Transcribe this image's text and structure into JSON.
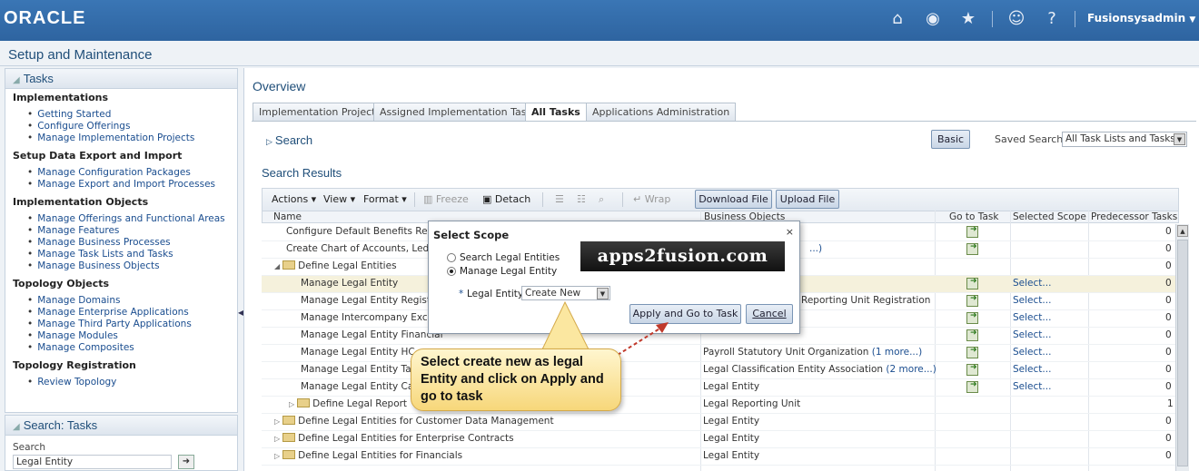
{
  "topbar": {
    "logo": "ORACLE",
    "icons": [
      "home-icon",
      "compass-icon",
      "star-icon",
      "accessibility-icon",
      "help-icon"
    ],
    "user": "Fusionsysadmin"
  },
  "page_title": "Setup and Maintenance",
  "tasks_panel": {
    "title": "Tasks",
    "sections": [
      {
        "title": "Implementations",
        "links": [
          "Getting Started",
          "Configure Offerings",
          "Manage Implementation Projects"
        ]
      },
      {
        "title": "Setup Data Export and Import",
        "links": [
          "Manage Configuration Packages",
          "Manage Export and Import Processes"
        ]
      },
      {
        "title": "Implementation Objects",
        "links": [
          "Manage Offerings and Functional Areas",
          "Manage Features",
          "Manage Business Processes",
          "Manage Task Lists and Tasks",
          "Manage Business Objects"
        ]
      },
      {
        "title": "Topology Objects",
        "links": [
          "Manage Domains",
          "Manage Enterprise Applications",
          "Manage Third Party Applications",
          "Manage Modules",
          "Manage Composites"
        ]
      },
      {
        "title": "Topology Registration",
        "links": [
          "Review Topology"
        ]
      }
    ]
  },
  "search_panel": {
    "title": "Search: Tasks",
    "label": "Search",
    "value": "Legal Entity"
  },
  "overview": {
    "title": "Overview",
    "tabs": [
      "Implementation Projects",
      "Assigned Implementation Tasks",
      "All Tasks",
      "Applications Administration"
    ],
    "active_tab": "All Tasks",
    "search_label": "Search",
    "basic_button": "Basic",
    "saved_search_label": "Saved Search",
    "saved_search_value": "All Task Lists and Tasks",
    "results_title": "Search Results",
    "toolbar": {
      "actions": "Actions",
      "view": "View",
      "format": "Format",
      "freeze": "Freeze",
      "detach": "Detach",
      "wrap": "Wrap",
      "download": "Download File",
      "upload": "Upload File"
    },
    "columns": [
      "Name",
      "Business Objects",
      "Go to Task",
      "Selected Scope",
      "Predecessor Tasks"
    ],
    "rows": [
      {
        "name": "Configure Default Benefits Relati",
        "bo": "",
        "scope": "",
        "pred": "0"
      },
      {
        "name": "Create Chart of Accounts, Ledge",
        "bo": "...)",
        "scope": "",
        "pred": "0"
      },
      {
        "name": "Define Legal Entities",
        "bo": "",
        "scope": "",
        "pred": "0"
      },
      {
        "name": "Manage Legal Entity",
        "bo": "",
        "scope": "Select...",
        "pred": "0"
      },
      {
        "name": "Manage Legal Entity Registra",
        "bo": "Reporting Unit Registration",
        "scope": "Select...",
        "pred": "0"
      },
      {
        "name": "Manage Intercompany Excep",
        "bo": "",
        "scope": "Select...",
        "pred": "0"
      },
      {
        "name": "Manage Legal Entity Financial",
        "bo": "",
        "scope": "Select...",
        "pred": "0"
      },
      {
        "name": "Manage Legal Entity HC",
        "bo": "Payroll Statutory Unit Organization",
        "more": "(1 more...)",
        "scope": "Select...",
        "pred": "0"
      },
      {
        "name": "Manage Legal Entity Ta",
        "bo": "Legal Classification Entity Association",
        "more": "(2 more...)",
        "scope": "Select...",
        "pred": "0"
      },
      {
        "name": "Manage Legal Entity Ca",
        "bo": "Legal Entity",
        "scope": "Select...",
        "pred": "0"
      },
      {
        "name": "Define Legal Report",
        "bo": "Legal Reporting Unit",
        "scope": "",
        "pred": "1"
      },
      {
        "name": "Define Legal Entities for Customer Data Management",
        "bo": "Legal Entity",
        "scope": "",
        "pred": "0"
      },
      {
        "name": "Define Legal Entities for Enterprise Contracts",
        "bo": "Legal Entity",
        "scope": "",
        "pred": "0"
      },
      {
        "name": "Define Legal Entities for Financials",
        "bo": "Legal Entity",
        "scope": "",
        "pred": "0"
      }
    ]
  },
  "dialog": {
    "title": "Select Scope",
    "close": "×",
    "option1": "Search Legal Entities",
    "option2": "Manage Legal Entity",
    "required_mark": "*",
    "legal_entity_label": "Legal Entity",
    "legal_entity_value": "Create New",
    "apply_button": "Apply and Go to Task",
    "cancel_button": "Cancel",
    "watermark": "apps2fusion.com"
  },
  "callout": {
    "text": "Select create new as legal Entity and click on Apply and go to task"
  }
}
